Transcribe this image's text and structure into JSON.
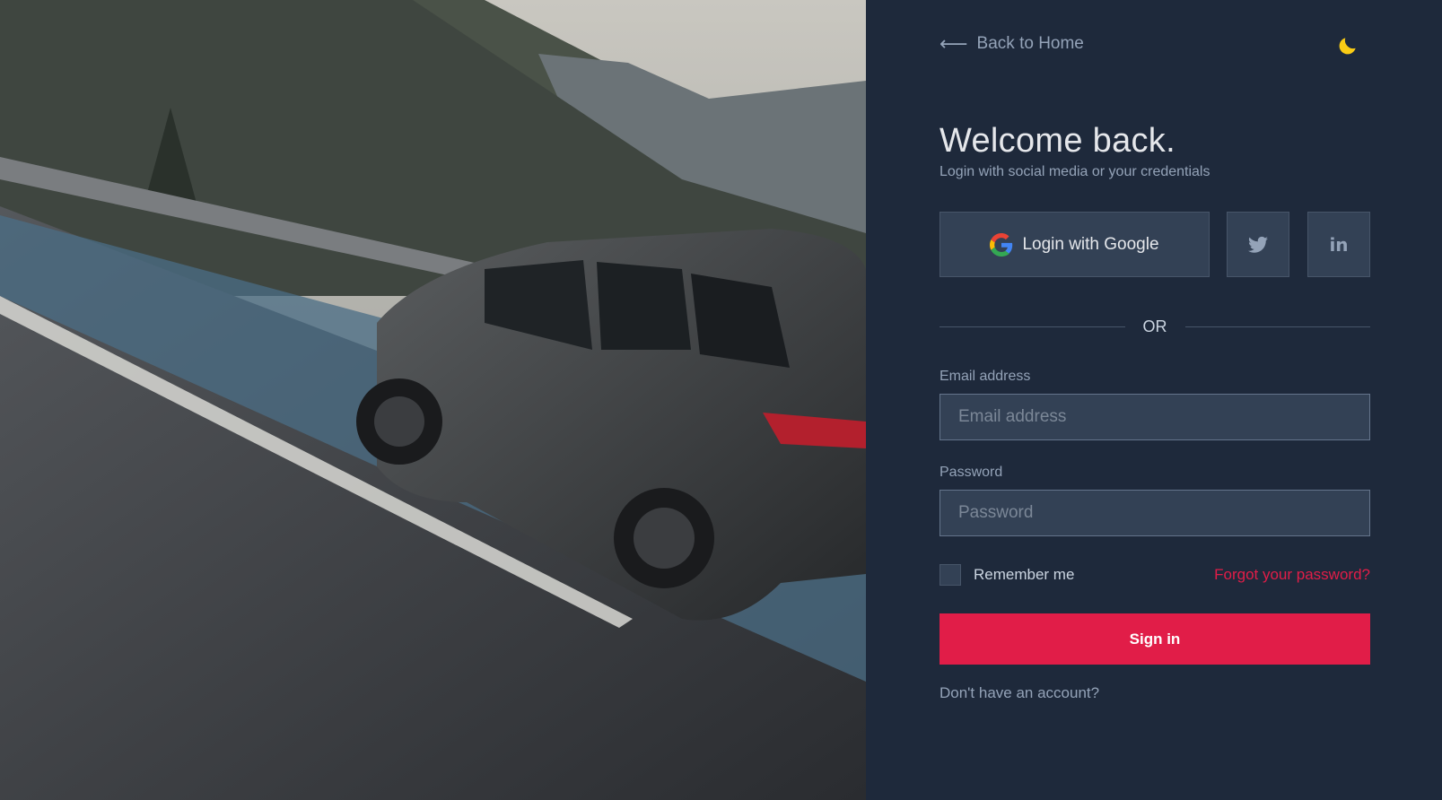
{
  "nav": {
    "back_label": "Back to Home",
    "back_icon": "arrow-left-icon",
    "theme_icon": "moon-icon"
  },
  "login": {
    "title": "Welcome back.",
    "subtitle": "Login with social media or your credentials",
    "google_label": "Login with Google",
    "twitter_icon": "twitter-icon",
    "linkedin_icon": "linkedin-icon",
    "linkedin_glyph": "in",
    "divider_text": "OR",
    "email": {
      "label": "Email address",
      "placeholder": "Email address",
      "value": ""
    },
    "password": {
      "label": "Password",
      "placeholder": "Password",
      "value": ""
    },
    "remember_label": "Remember me",
    "forgot_label": "Forgot your password?",
    "signin_label": "Sign in",
    "signup_label": "Don't have an account?"
  },
  "colors": {
    "panel_bg": "#1e293b",
    "field_bg": "#334155",
    "accent": "#e11d48",
    "moon": "#facc15",
    "muted_text": "#94a3b8"
  }
}
